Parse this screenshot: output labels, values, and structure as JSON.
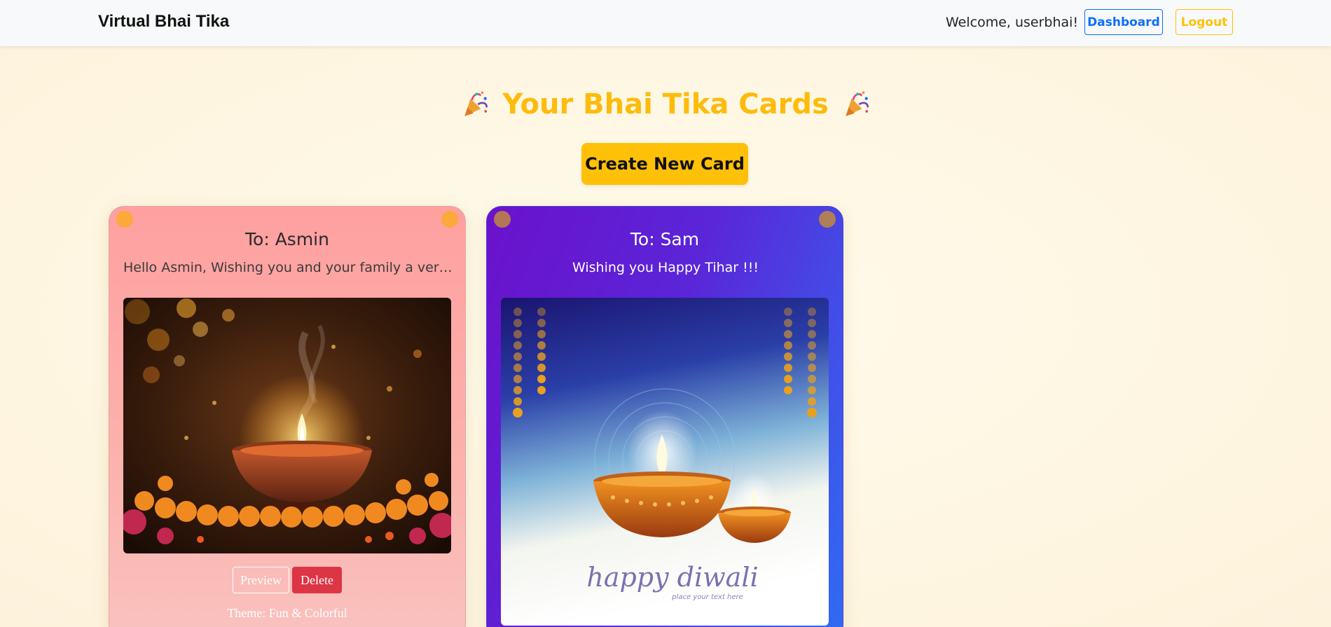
{
  "navbar": {
    "brand": "Virtual Bhai Tika",
    "welcome": "Welcome, userbhai!",
    "dashboard_label": "Dashboard",
    "logout_label": "Logout"
  },
  "page": {
    "title": "Your Bhai Tika Cards",
    "create_label": "Create New Card"
  },
  "cards": [
    {
      "to": "To: Asmin",
      "message": "Hello Asmin, Wishing you and your family a very H...",
      "image": "diya-lamp-marigold-image",
      "preview_label": "Preview",
      "delete_label": "Delete",
      "theme": "Theme: Fun & Colorful"
    },
    {
      "to": "To: Sam",
      "message": "Wishing you Happy Tihar !!!",
      "image": "happy-diwali-diyas-image",
      "image_text": "happy diwali",
      "image_subtext": "place your text here"
    }
  ],
  "colors": {
    "accent": "#ffc107",
    "title": "#fdbb0b",
    "primary": "#0d6efd",
    "danger": "#dc3545"
  }
}
